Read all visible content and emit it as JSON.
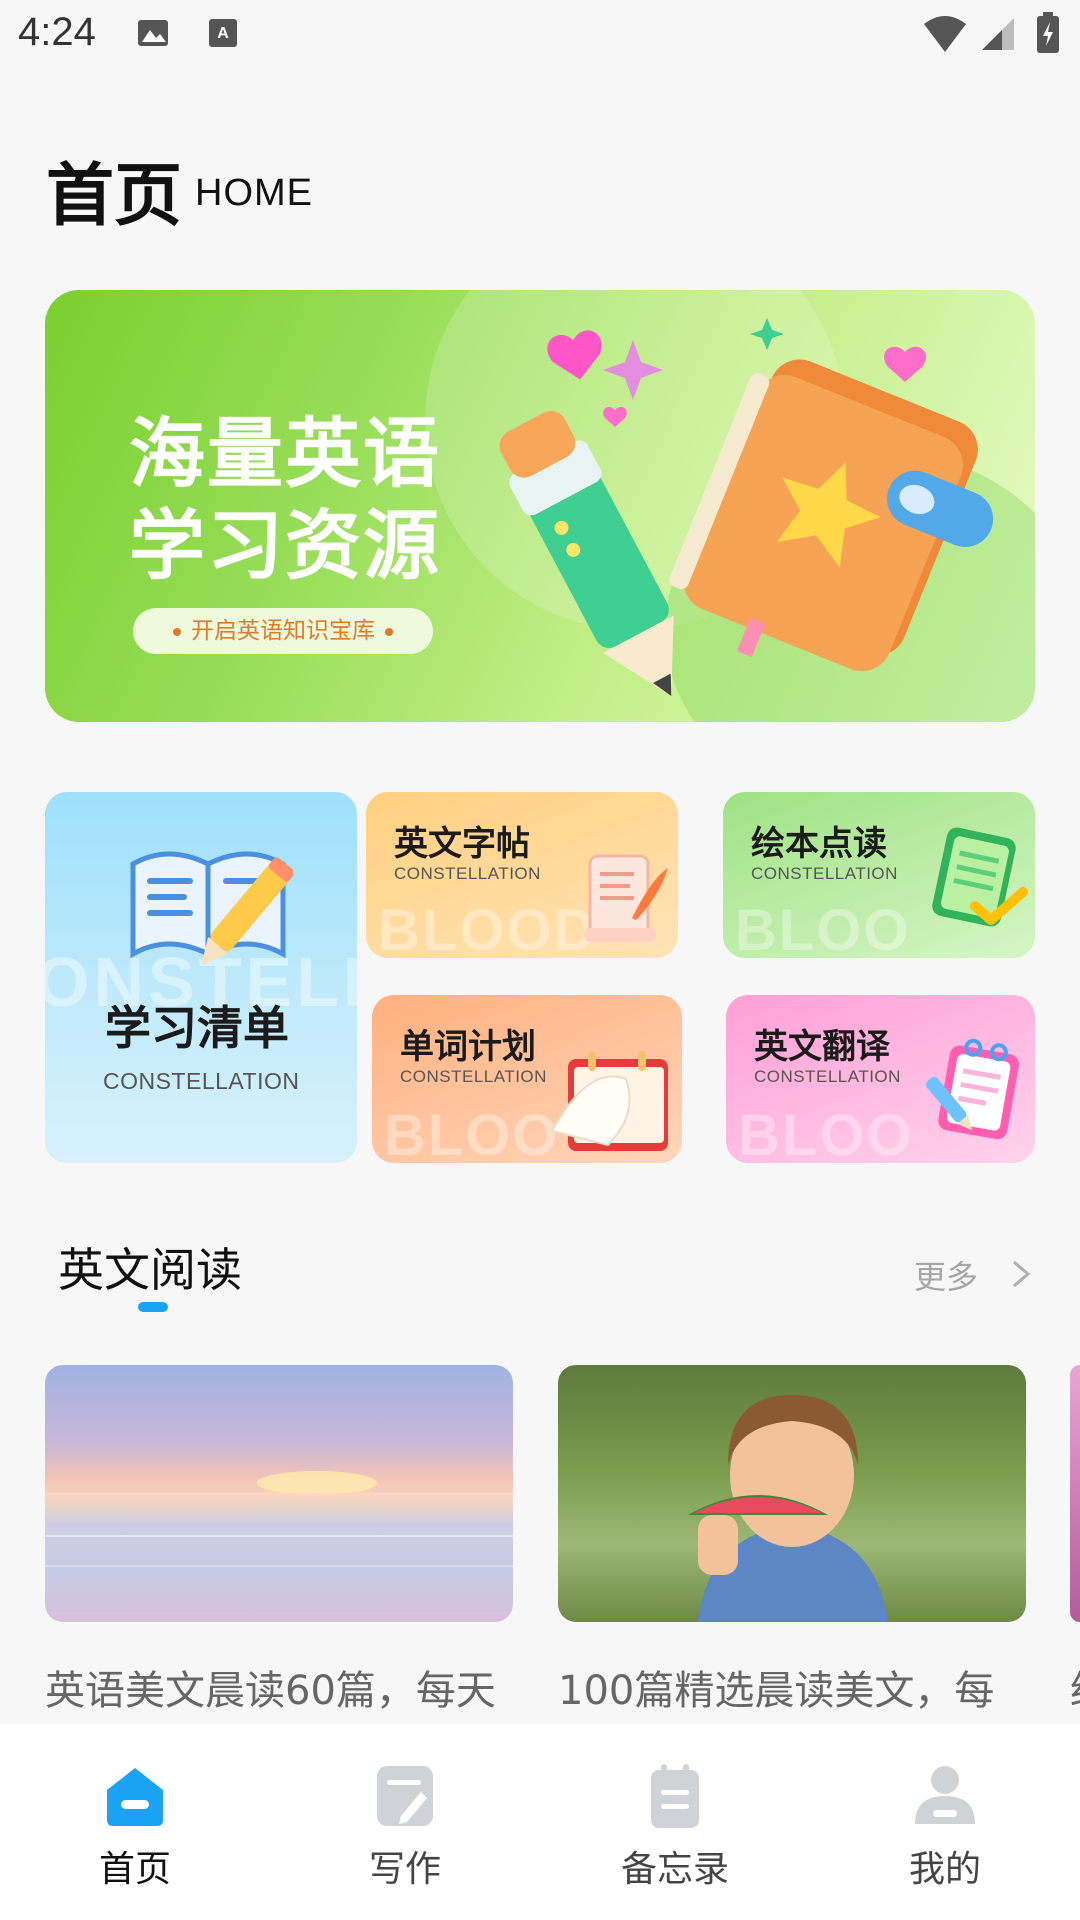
{
  "status_bar": {
    "time": "4:24"
  },
  "header": {
    "title": "首页",
    "subtitle": "HOME"
  },
  "banner": {
    "title_line1": "海量英语",
    "title_line2": "学习资源",
    "pill": "开启英语知识宝库"
  },
  "categories": [
    {
      "title": "学习清单",
      "subtitle": "CONSTELLATION",
      "watermark": "ONSTELL"
    },
    {
      "title": "英文字帖",
      "subtitle": "CONSTELLATION",
      "watermark": "BLOOD"
    },
    {
      "title": "绘本点读",
      "subtitle": "CONSTELLATION",
      "watermark": "BLOO"
    },
    {
      "title": "单词计划",
      "subtitle": "CONSTELLATION",
      "watermark": "BLOO"
    },
    {
      "title": "英文翻译",
      "subtitle": "CONSTELLATION",
      "watermark": "BLOO"
    }
  ],
  "reading_section": {
    "title": "英文阅读",
    "more": "更多"
  },
  "articles": [
    {
      "title": "英语美文晨读60篇，每天"
    },
    {
      "title": "100篇精选晨读美文，每"
    },
    {
      "title": "经"
    }
  ],
  "bottom_nav": [
    {
      "label": "首页",
      "icon": "home-icon",
      "active": true
    },
    {
      "label": "写作",
      "icon": "write-icon",
      "active": false
    },
    {
      "label": "备忘录",
      "icon": "memo-icon",
      "active": false
    },
    {
      "label": "我的",
      "icon": "profile-icon",
      "active": false
    }
  ],
  "colors": {
    "accent": "#1aa3f5",
    "inactive_icon": "#cfd3d8"
  }
}
